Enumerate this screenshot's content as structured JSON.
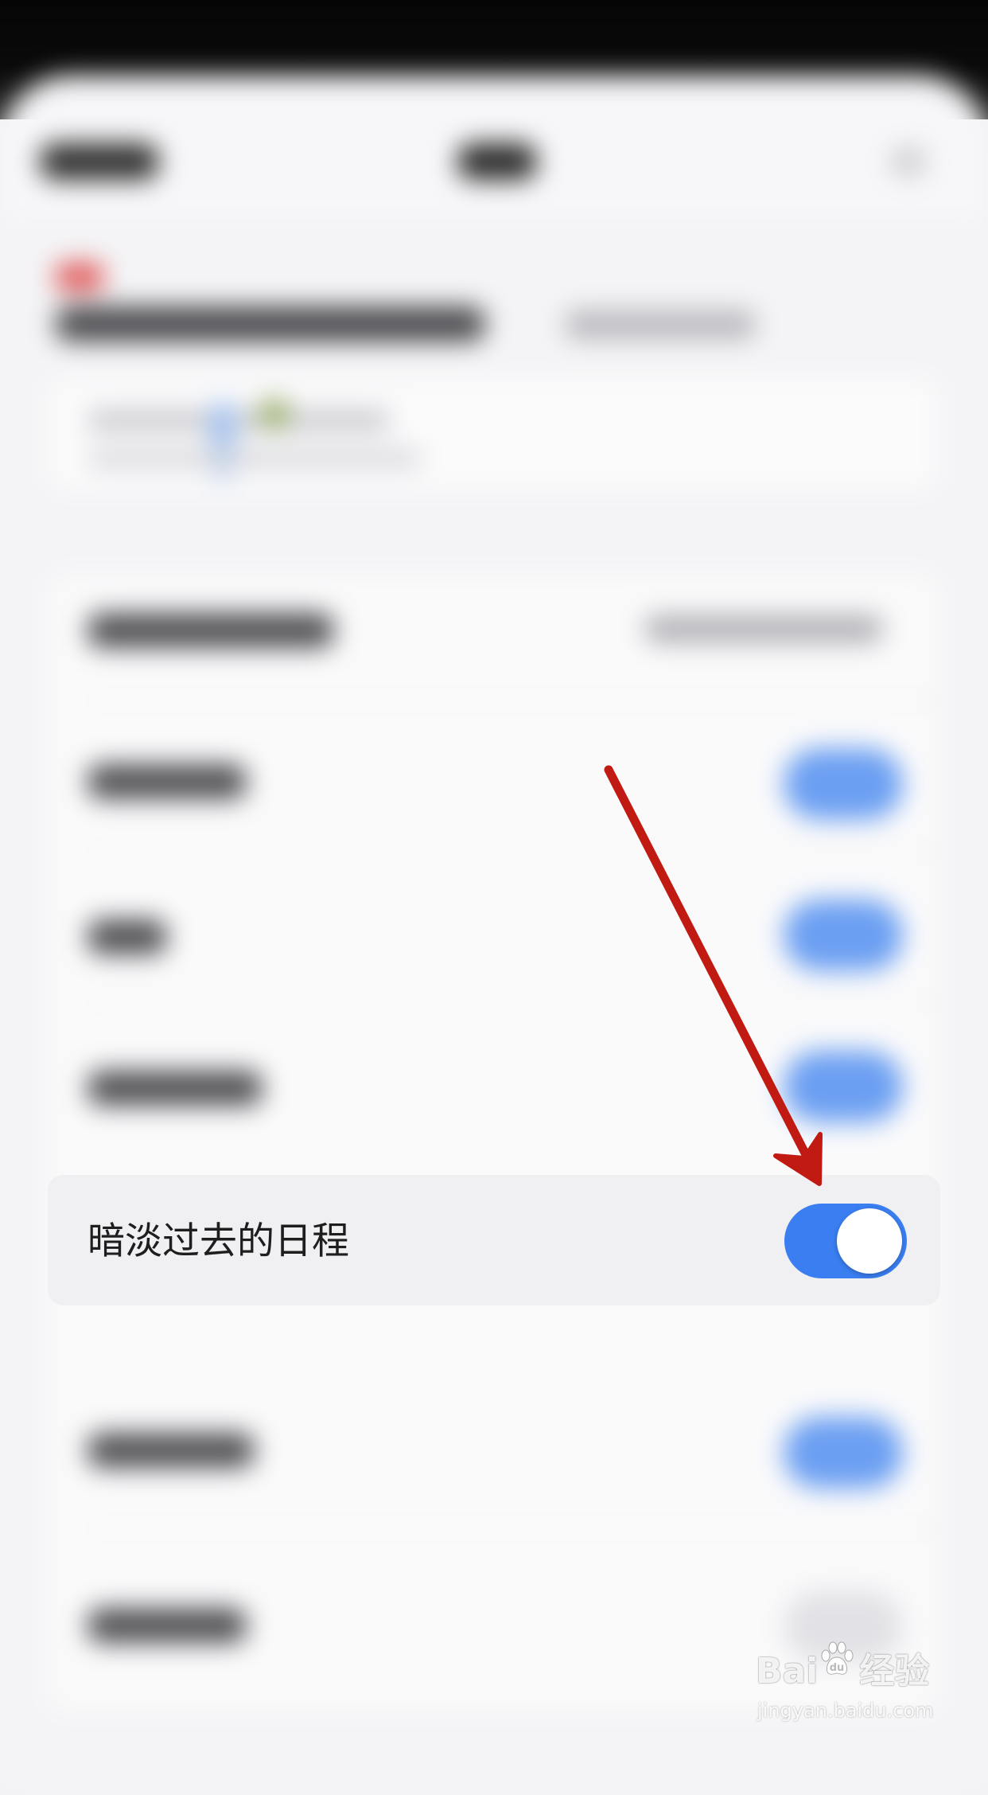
{
  "setting_row": {
    "label": "暗淡过去的日程",
    "toggle_state": "on"
  },
  "watermark": {
    "brand": "Bai",
    "brand_suffix": "经验",
    "url": "jingyan.baidu.com"
  },
  "colors": {
    "toggle_on": "#3a7ef1",
    "arrow": "#c01a12",
    "background": "#f2f2f4"
  }
}
